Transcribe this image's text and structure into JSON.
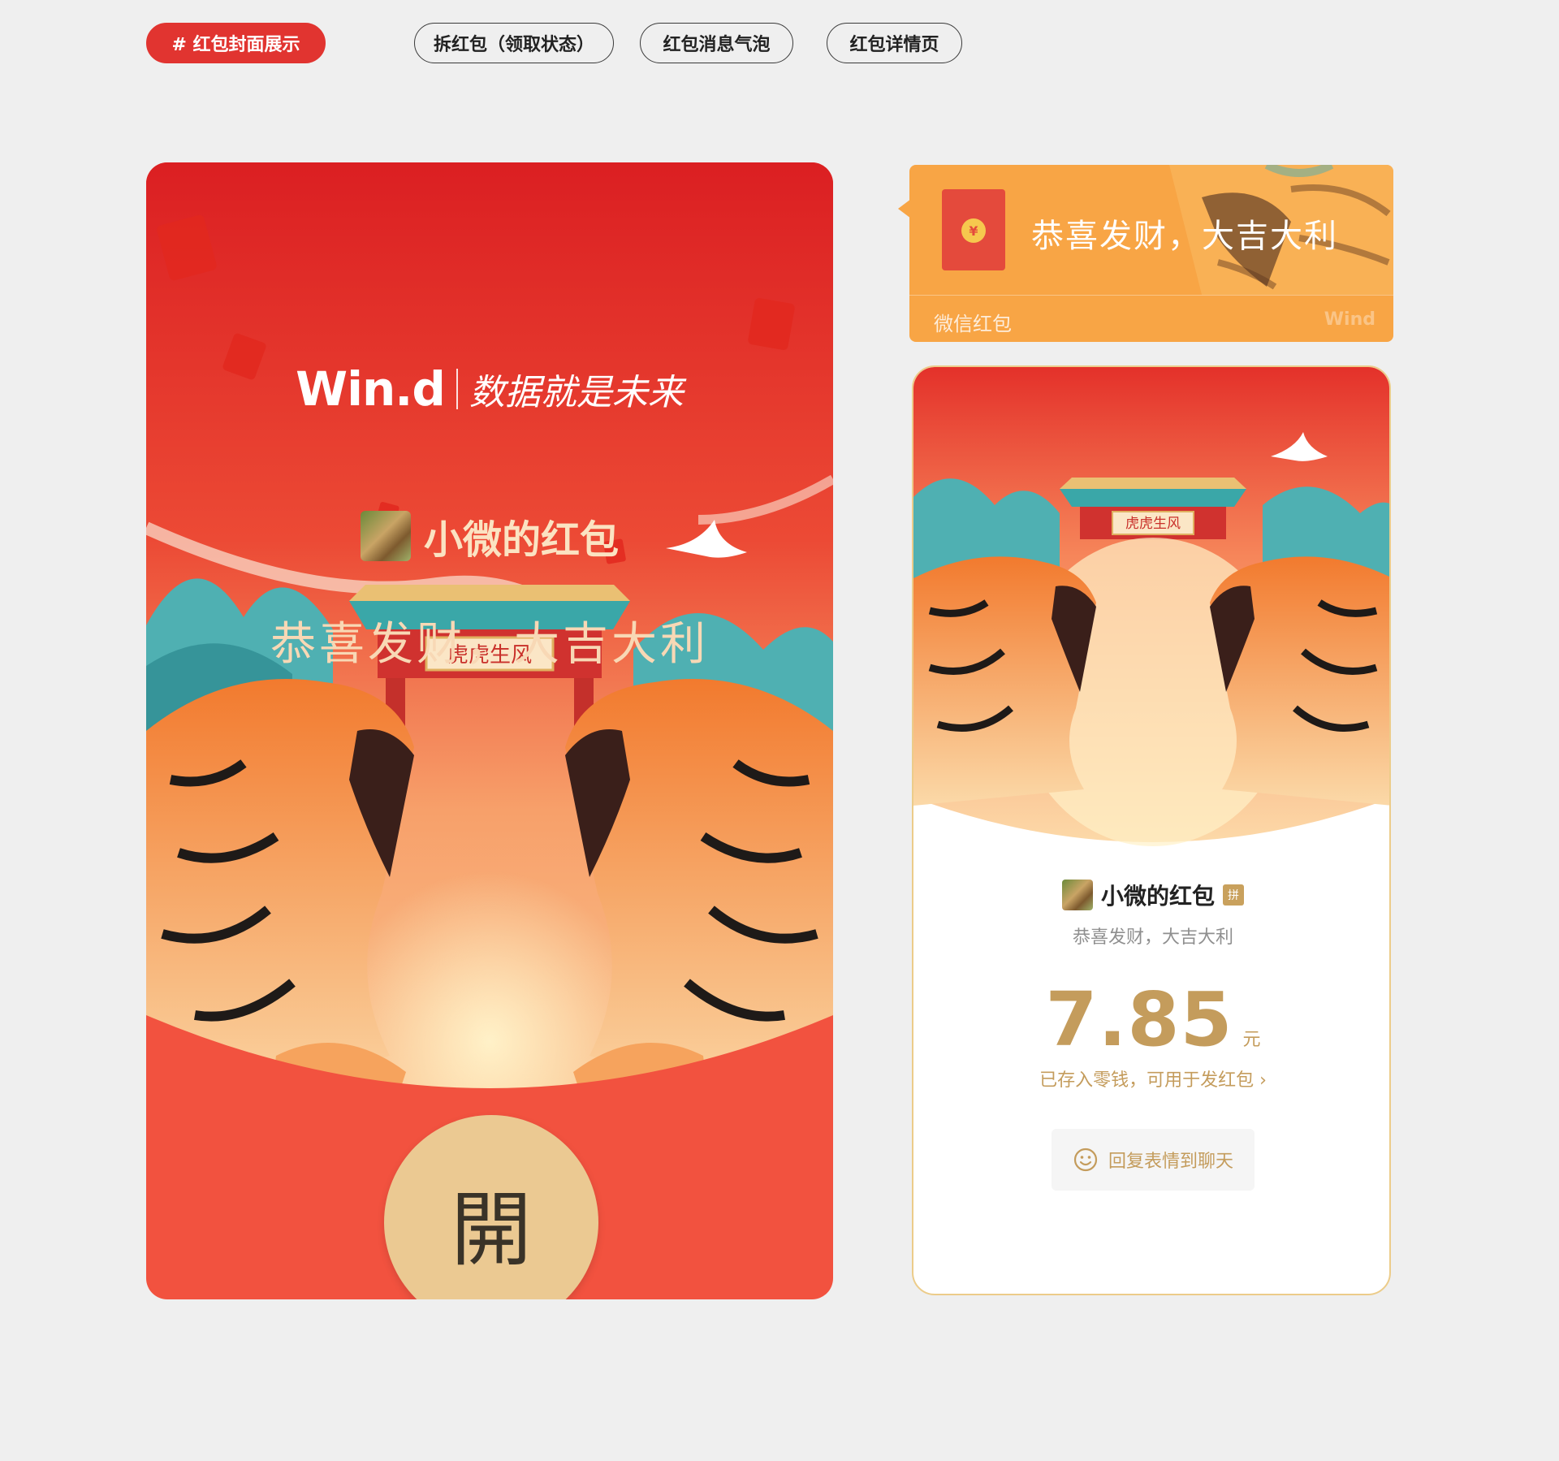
{
  "tabs": [
    {
      "label": "# 红包封面展示",
      "active": true
    },
    {
      "label": "拆红包（领取状态）",
      "active": false
    },
    {
      "label": "红包消息气泡",
      "active": false
    },
    {
      "label": "红包详情页",
      "active": false
    }
  ],
  "cover": {
    "brand_logo": "Win.d",
    "brand_slogan": "数据就是未来",
    "sender_name": "小微的红包",
    "greeting": "恭喜发财，大吉大利",
    "gate_sign": "虎虎生风",
    "open_label": "開"
  },
  "bubble": {
    "title": "恭喜发财，大吉大利",
    "label": "微信红包",
    "brand": "Wind",
    "coin_symbol": "¥"
  },
  "detail": {
    "gate_sign": "虎虎生风",
    "sender_name": "小微的红包",
    "badge": "拼",
    "greeting": "恭喜发财，大吉大利",
    "amount": "7.85",
    "unit": "元",
    "note": "已存入零钱，可用于发红包 ›",
    "reply_label": "回复表情到聊天"
  },
  "colors": {
    "accent_red": "#e13430",
    "cover_red": "#f2523f",
    "gold": "#ebc992",
    "bubble_orange": "#f8a545",
    "amount_gold": "#c49c5c"
  }
}
